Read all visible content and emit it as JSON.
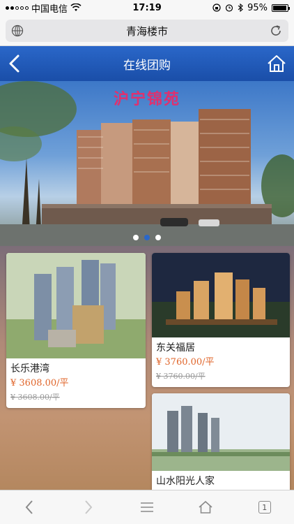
{
  "status_bar": {
    "carrier": "中国电信",
    "time": "17:19",
    "battery_percent": "95%",
    "battery_level": 0.95
  },
  "browser": {
    "url_title": "青海楼市",
    "toolbar": {
      "tabs_count": "1"
    }
  },
  "header": {
    "title": "在线团购"
  },
  "banner": {
    "title": "沪宁锦苑",
    "slide_count": 3,
    "active_slide": 2
  },
  "listings": [
    {
      "name": "长乐港湾",
      "price": "¥ 3608.00/平",
      "old_price": "¥ 3608.00/平"
    },
    {
      "name": "东关福居",
      "price": "¥ 3760.00/平",
      "old_price": "¥ 3760.00/平"
    },
    {
      "name": "山水阳光人家"
    }
  ],
  "colors": {
    "header_blue": "#1f58b4",
    "price_orange": "#e0652a",
    "banner_title_pink": "#e0306e"
  }
}
